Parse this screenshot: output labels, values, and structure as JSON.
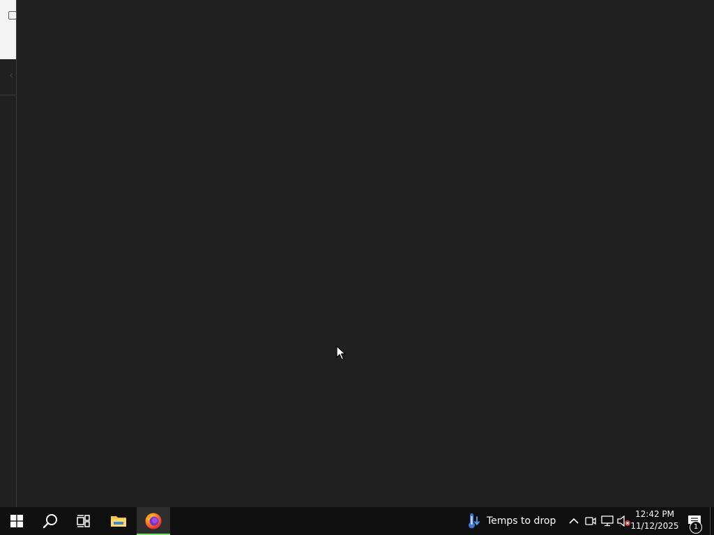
{
  "taskbar": {
    "buttons": [
      {
        "name": "start",
        "icon": "windows-logo-icon"
      },
      {
        "name": "search",
        "icon": "search-icon"
      },
      {
        "name": "task-view",
        "icon": "task-view-icon"
      },
      {
        "name": "file-explorer",
        "icon": "folder-icon"
      },
      {
        "name": "firefox",
        "icon": "firefox-icon",
        "active": true
      }
    ],
    "weather": {
      "text": "Temps to drop",
      "icon": "thermometer-icon"
    },
    "tray": {
      "icons": [
        "chevron-up-icon",
        "meet-now-icon",
        "network-icon",
        "volume-muted-icon"
      ]
    },
    "clock": {
      "time": "12:42 PM",
      "date": "11/12/2025"
    },
    "notifications": {
      "count": "1",
      "icon": "action-center-icon"
    }
  },
  "colors": {
    "desktop_bg": "#202020",
    "taskbar_bg": "#0f0f0f",
    "active_indicator": "#76e06b"
  }
}
